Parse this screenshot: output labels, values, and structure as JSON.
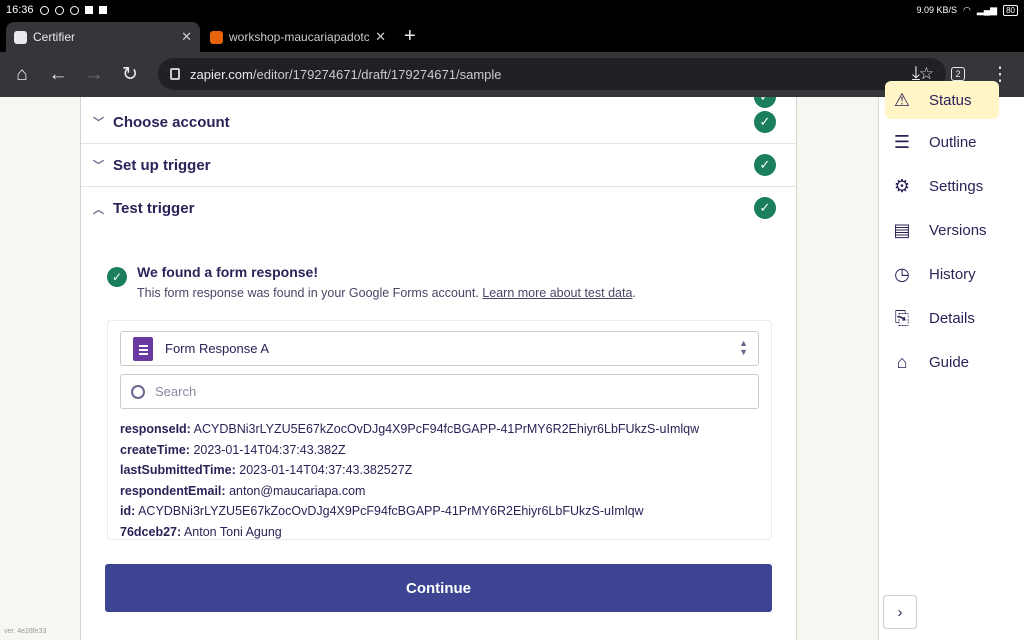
{
  "statusbar": {
    "time": "16:36",
    "speed": "9.09 KB/S",
    "battery": "80"
  },
  "tabs": [
    {
      "title": "Certifier",
      "favicon_color": "#e8eaed"
    },
    {
      "title": "workshop-maucariapadotcom",
      "favicon_color": "#e8630a"
    }
  ],
  "toolbar": {
    "url_host": "zapier.com",
    "url_path": "/editor/179274671/draft/179274671/sample",
    "tab_count": "2"
  },
  "steps": [
    {
      "label": "Choose account",
      "expanded": false
    },
    {
      "label": "Set up trigger",
      "expanded": false
    },
    {
      "label": "Test trigger",
      "expanded": true
    }
  ],
  "result": {
    "title": "We found a form response!",
    "description": "This form response was found in your Google Forms account. ",
    "learn_more": "Learn more about test data",
    "period": "."
  },
  "record_select": {
    "value": "Form Response A"
  },
  "search": {
    "placeholder": "Search"
  },
  "fields": [
    {
      "key": "responseId:",
      "value": "ACYDBNi3rLYZU5E67kZocOvDJg4X9PcF94fcBGAPP-41PrMY6R2Ehiyr6LbFUkzS-uImlqw"
    },
    {
      "key": "createTime:",
      "value": "2023-01-14T04:37:43.382Z"
    },
    {
      "key": "lastSubmittedTime:",
      "value": "2023-01-14T04:37:43.382527Z"
    },
    {
      "key": "respondentEmail:",
      "value": "anton@maucariapa.com"
    },
    {
      "key": "id:",
      "value": "ACYDBNi3rLYZU5E67kZocOvDJg4X9PcF94fcBGAPP-41PrMY6R2Ehiyr6LbFUkzS-uImlqw"
    },
    {
      "key": "76dceb27:",
      "value": "Anton Toni Agung"
    }
  ],
  "continue_label": "Continue",
  "version": "ver. 4e28fe33",
  "sidebar": {
    "items": [
      {
        "label": "Status",
        "icon": "warning-icon",
        "glyph": "⚠"
      },
      {
        "label": "Outline",
        "icon": "list-icon",
        "glyph": "☰"
      },
      {
        "label": "Settings",
        "icon": "gear-icon",
        "glyph": "⚙"
      },
      {
        "label": "Versions",
        "icon": "layers-icon",
        "glyph": "▤"
      },
      {
        "label": "History",
        "icon": "clock-icon",
        "glyph": "◷"
      },
      {
        "label": "Details",
        "icon": "document-bolt-icon",
        "glyph": "⎘"
      },
      {
        "label": "Guide",
        "icon": "graduation-cap-icon",
        "glyph": "⌂"
      }
    ],
    "expand_glyph": "›"
  },
  "colors": {
    "accent": "#3d4592",
    "success": "#1a7f5a",
    "status_highlight": "#fff5c7"
  }
}
